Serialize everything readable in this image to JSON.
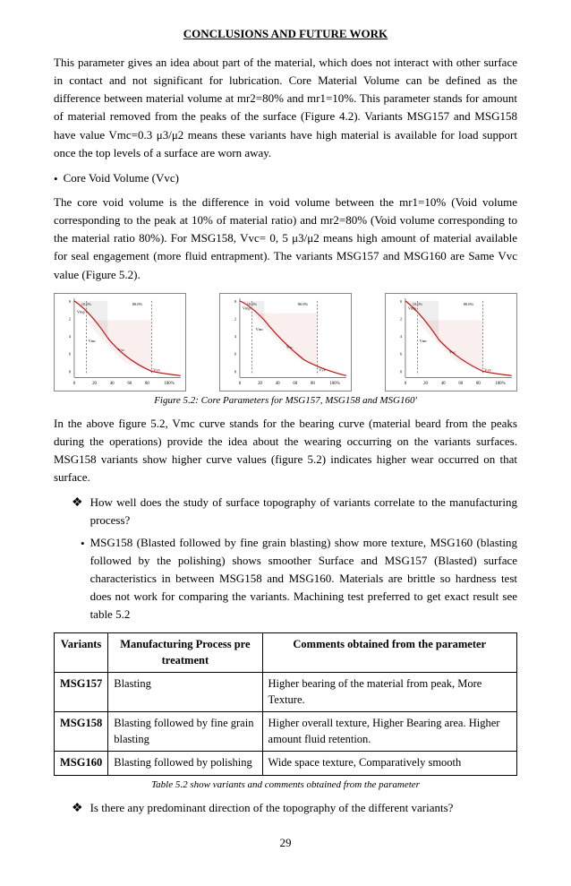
{
  "page": {
    "title": "CONCLUSIONS AND FUTURE WORK",
    "page_number": "29"
  },
  "paragraphs": {
    "p1": "This parameter gives an idea about part of the material, which does not interact with other surface in contact and not significant for lubrication. Core Material Volume can be defined as the difference between material volume at mr2=80% and mr1=10%. This parameter stands for amount of material removed from the peaks of the surface (Figure 4.2). Variants MSG157 and MSG158 have value Vmc=0.3 μ3/μ2 means these variants have high material is available for load support once the top levels of a surface are worn away.",
    "bullet1_label": "Core Void Volume (Vvc)",
    "p2": "The core void volume is the difference in void volume between the mr1=10% (Void volume corresponding to the peak at 10% of material ratio) and mr2=80% (Void volume corresponding to the material ratio 80%). For MSG158, Vvc= 0, 5 μ3/μ2 means high amount of material available for seal engagement (more fluid entrapment). The variants MSG157 and MSG160 are Same Vvc value (Figure 5.2).",
    "figure_caption": "Figure 5.2: Core Parameters for MSG157, MSG158 and MSG160'",
    "p3": "In the above figure 5.2, Vmc curve stands for the bearing curve (material beard from the peaks during the operations) provide the idea about the wearing occurring on the variants surfaces. MSG158 variants show higher curve values (figure 5.2) indicates higher wear occurred on that surface.",
    "diamond_q1": "How well does the study of surface topography of variants correlate to the manufacturing process?",
    "bullet2_text": "MSG158 (Blasted followed by fine grain blasting) show more texture, MSG160 (blasting followed by the polishing) shows smoother Surface and MSG157 (Blasted) surface characteristics in between MSG158 and MSG160. Materials are brittle so hardness test does not work for comparing the variants. Machining test preferred to get exact result see table 5.2",
    "diamond_q2": "Is there any predominant direction of the topography of the different variants?"
  },
  "table": {
    "headers": [
      "Variants",
      "Manufacturing Process pre treatment",
      "Comments obtained from the parameter"
    ],
    "rows": [
      {
        "variant": "MSG157",
        "process": "Blasting",
        "comments": "Higher bearing of the material from peak, More Texture."
      },
      {
        "variant": "MSG158",
        "process": "Blasting followed by fine grain blasting",
        "comments": "Higher overall texture, Higher Bearing area. Higher amount fluid retention."
      },
      {
        "variant": "MSG160",
        "process": "Blasting followed by polishing",
        "comments": "Wide space texture, Comparatively smooth"
      }
    ],
    "caption": "Table 5.2 show variants and comments obtained from the parameter"
  },
  "figures": [
    {
      "id": "fig1",
      "label": "MSG157"
    },
    {
      "id": "fig2",
      "label": "MSG158"
    },
    {
      "id": "fig3",
      "label": "MSG160"
    }
  ]
}
